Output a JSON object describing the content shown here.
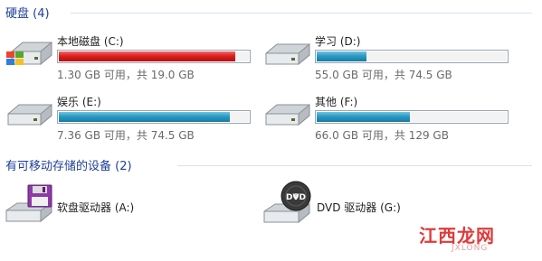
{
  "hard_disks": {
    "title": "硬盘 (4)",
    "drives": [
      {
        "name": "本地磁盘 (C:)",
        "free_text": "1.30 GB 可用，共 19.0 GB",
        "used_fraction": 0.93,
        "bar_color": "#dc1f1f",
        "icon": "windows-hard-disk-icon"
      },
      {
        "name": "学习 (D:)",
        "free_text": "55.0 GB 可用，共 74.5 GB",
        "used_fraction": 0.26,
        "bar_color": "#2b9bc4",
        "icon": "hard-disk-icon"
      },
      {
        "name": "娱乐 (E:)",
        "free_text": "7.36 GB 可用，共 74.5 GB",
        "used_fraction": 0.9,
        "bar_color": "#2b9bc4",
        "icon": "hard-disk-icon"
      },
      {
        "name": "其他 (F:)",
        "free_text": "66.0 GB 可用，共 129 GB",
        "used_fraction": 0.49,
        "bar_color": "#2b9bc4",
        "icon": "hard-disk-icon"
      }
    ]
  },
  "removable": {
    "title": "有可移动存储的设备 (2)",
    "devices": [
      {
        "name": "软盘驱动器 (A:)",
        "icon": "floppy-drive-icon"
      },
      {
        "name": "DVD 驱动器 (G:)",
        "icon": "dvd-drive-icon",
        "disc_text": "DVD"
      }
    ]
  },
  "watermark": {
    "text": "江西龙网",
    "latin": "JXLONG"
  }
}
